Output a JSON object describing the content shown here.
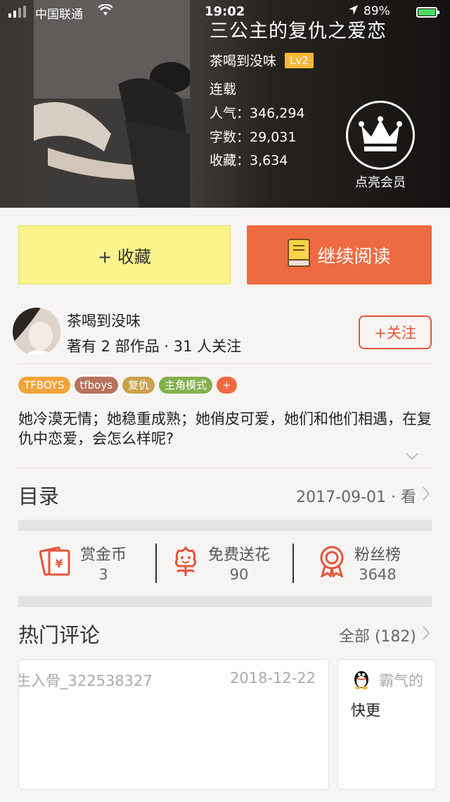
{
  "status_bar": {
    "carrier": "中国联通",
    "time": "19:02",
    "battery": "89%"
  },
  "book": {
    "title": "三公主的复仇之爱恋",
    "author": "茶喝到没味",
    "level": "Lv2",
    "status": "连载",
    "popularity": "人气：346,294",
    "word_count": "字数：29,031",
    "favorites": "收藏：3,634"
  },
  "vip": {
    "label": "点亮会员"
  },
  "actions": {
    "collect_label": "+ 收藏",
    "read_label": "继续阅读"
  },
  "author_card": {
    "name": "茶喝到没味",
    "stats": "著有 2 部作品 · 31 人关注",
    "follow_label": "+关注"
  },
  "tags": [
    {
      "label": "TFBOYS",
      "color": "#f2a43a"
    },
    {
      "label": "tfboys",
      "color": "#b7735c"
    },
    {
      "label": "复仇",
      "color": "#c9a24a"
    },
    {
      "label": "主角模式",
      "color": "#84b04e"
    },
    {
      "label": "+",
      "color": "#ee6a41"
    }
  ],
  "description": "她冷漠无情；她稳重成熟；她俏皮可爱，她们和他们相遇，在复仇中恋爱，会怎么样呢?",
  "catalog": {
    "title": "目录",
    "latest": "2017-09-01 · 看"
  },
  "stats": [
    {
      "label": "赏金币",
      "value": "3",
      "icon": "red-envelope-icon"
    },
    {
      "label": "免费送花",
      "value": "90",
      "icon": "flower-icon"
    },
    {
      "label": "粉丝榜",
      "value": "3648",
      "icon": "award-badge-icon"
    }
  ],
  "comments": {
    "title": "热门评论",
    "all_label": "全部 (182)",
    "items": [
      {
        "user": "生入骨_322538327",
        "date": "2018-12-22",
        "text": ""
      },
      {
        "user": "霸气的",
        "date": "",
        "text": "快更"
      }
    ]
  },
  "colors": {
    "accent": "#ee6a41",
    "collect_bg": "#fbf48a",
    "level_badge": "#f4b93a",
    "icon_red": "#e4553b"
  }
}
